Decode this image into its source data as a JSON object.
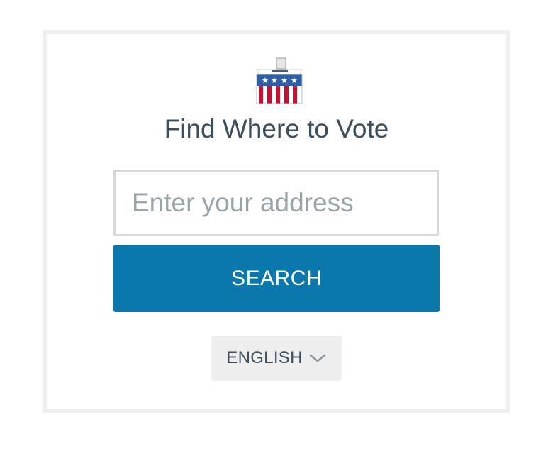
{
  "widget": {
    "title": "Find Where to Vote",
    "icon": "ballot-box-icon",
    "search": {
      "placeholder": "Enter your address",
      "value": ""
    },
    "search_button_label": "SEARCH",
    "language": {
      "selected": "ENGLISH",
      "icon": "chevron-down-icon"
    }
  },
  "colors": {
    "accent": "#0a78ac",
    "title_text": "#3d4f5c",
    "placeholder_text": "#99a3aa",
    "frame_border": "#eeeeee",
    "flag_red": "#c8102e",
    "flag_blue": "#2d5fa8"
  }
}
